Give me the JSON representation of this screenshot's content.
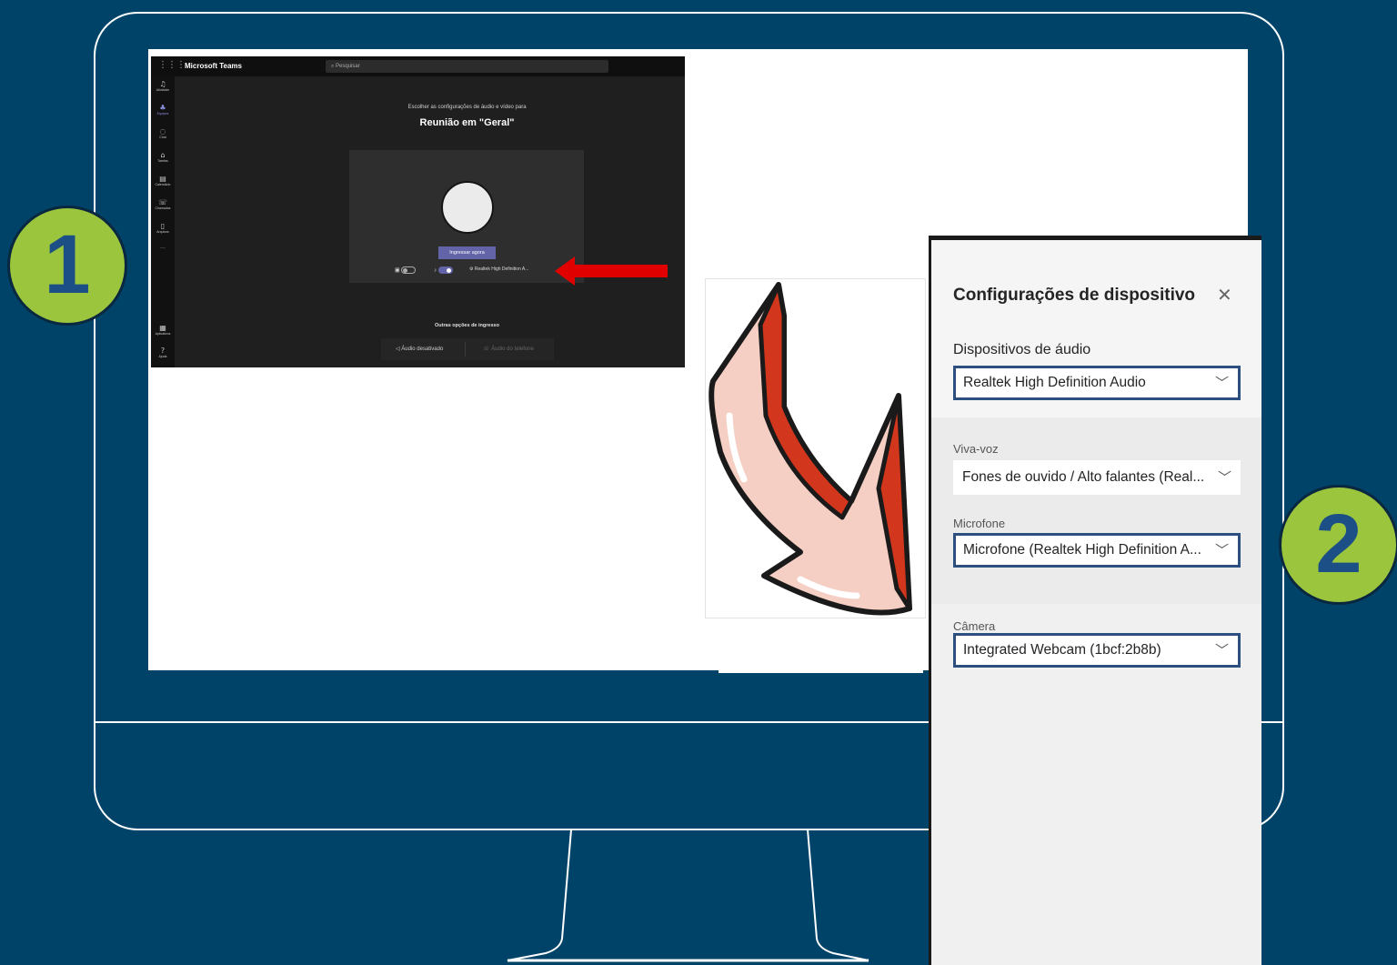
{
  "teams": {
    "app_title": "Microsoft Teams",
    "search_placeholder": "Pesquisar",
    "rail_items": [
      {
        "label": "Atividade",
        "icon": "bell-icon"
      },
      {
        "label": "Equipes",
        "icon": "teams-icon"
      },
      {
        "label": "Chat",
        "icon": "chat-icon"
      },
      {
        "label": "Tarefas",
        "icon": "tasks-icon"
      },
      {
        "label": "Calendário",
        "icon": "calendar-icon"
      },
      {
        "label": "Chamadas",
        "icon": "phone-icon"
      },
      {
        "label": "Arquivos",
        "icon": "file-icon"
      }
    ],
    "rail_more": "···",
    "rail_bottom": [
      {
        "label": "Aplicativos",
        "icon": "apps-icon"
      },
      {
        "label": "Ajuda",
        "icon": "help-icon"
      }
    ],
    "subtitle": "Escolher as configurações de áudio e vídeo para",
    "meeting_title": "Reunião em \"Geral\"",
    "join_button": "Ingressar agora",
    "device_label": "Realtek High Definition A...",
    "other_options": "Outras opções de ingresso",
    "audio_off": "Áudio desativado",
    "phone_audio": "Áudio do telefone"
  },
  "settings": {
    "title": "Configurações de dispositivo",
    "audio_section": "Dispositivos de áudio",
    "audio_device": "Realtek High Definition Audio",
    "speaker_label": "Viva-voz",
    "speaker_value": "Fones de ouvido / Alto falantes (Real...",
    "mic_label": "Microfone",
    "mic_value": "Microfone (Realtek High Definition A...",
    "camera_label": "Câmera",
    "camera_value": "Integrated Webcam (1bcf:2b8b)"
  },
  "badges": {
    "one": "1",
    "two": "2"
  },
  "colors": {
    "background": "#004369",
    "badge_fill": "#9ac53c",
    "badge_text": "#1c4f86",
    "teams_accent": "#6264a7",
    "highlight_border": "#2b4f7e",
    "red_arrow": "#e00000"
  }
}
